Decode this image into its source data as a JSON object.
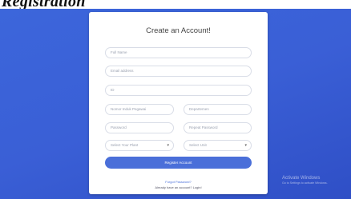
{
  "page_heading": "Registration",
  "form": {
    "title": "Create an Account!",
    "full_name_placeholder": "Full Name",
    "email_placeholder": "Email address",
    "id_placeholder": "ID",
    "phone_placeholder": "Nomor Induk Pegawai",
    "department_placeholder": "Departemen",
    "password_placeholder": "Password",
    "repeat_password_placeholder": "Repeat Password",
    "plant_select": "Select Your Plant",
    "unit_select": "Select Unit",
    "register_button": "Register Account",
    "forgot_password": "Forgot Password?",
    "login_link": "Already have an account? Login!"
  },
  "watermark": {
    "title": "Activate Windows",
    "subtitle": "Go to Settings to activate Windows."
  }
}
